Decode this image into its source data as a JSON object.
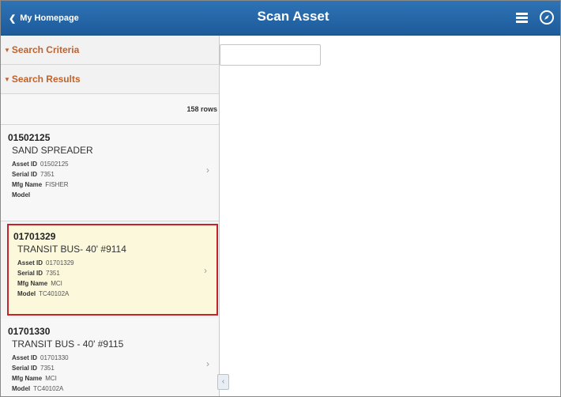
{
  "header": {
    "back_label": "My Homepage",
    "back_icon": "chevron-left-icon",
    "title": "Scan Asset",
    "menu_icon": "hamburger-menu-icon",
    "nav_icon": "navbar-compass-icon",
    "color": "#2563a6"
  },
  "panel": {
    "search_criteria_label": "Search Criteria",
    "search_results_label": "Search Results",
    "rows_count": "158 rows",
    "section_color": "#c0622a",
    "results": [
      {
        "id": "01502125",
        "description": "SAND SPREADER",
        "asset_id_label": "Asset ID",
        "asset_id": "01502125",
        "serial_id_label": "Serial ID",
        "serial_id": "7351",
        "mfg_name_label": "Mfg Name",
        "mfg_name": "FISHER",
        "model_label": "Model",
        "model": ""
      },
      {
        "id": "01701329",
        "description": "TRANSIT BUS- 40'  #9114",
        "asset_id_label": "Asset ID",
        "asset_id": "01701329",
        "serial_id_label": "Serial ID",
        "serial_id": "7351",
        "mfg_name_label": "Mfg Name",
        "mfg_name": "MCI",
        "model_label": "Model",
        "model": "TC40102A"
      },
      {
        "id": "01701330",
        "description": "TRANSIT BUS - 40'  #9115",
        "asset_id_label": "Asset ID",
        "asset_id": "01701330",
        "serial_id_label": "Serial ID",
        "serial_id": "7351",
        "mfg_name_label": "Mfg Name",
        "mfg_name": "MCI",
        "model_label": "Model",
        "model": "TC40102A"
      }
    ]
  },
  "search_field": {
    "value": ""
  }
}
